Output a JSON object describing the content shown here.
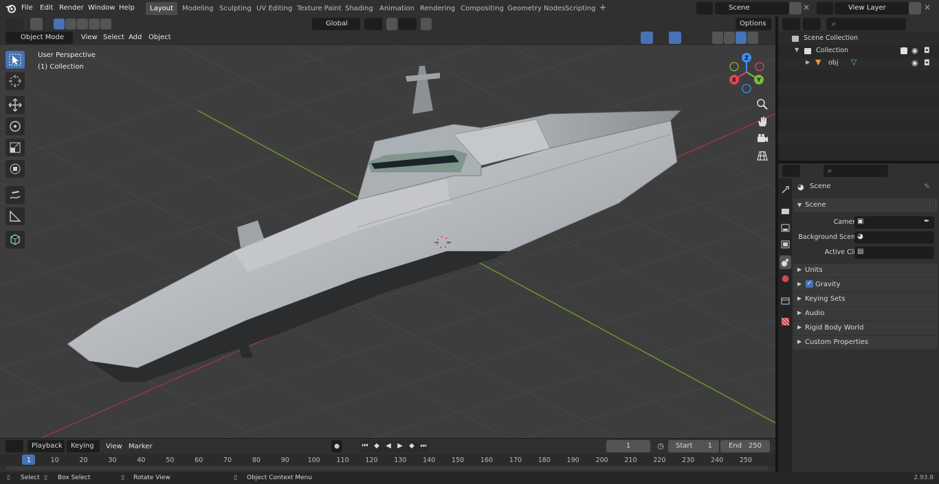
{
  "topbar": {
    "menus": [
      "File",
      "Edit",
      "Render",
      "Window",
      "Help"
    ],
    "workspaces": [
      "Layout",
      "Modeling",
      "Sculpting",
      "UV Editing",
      "Texture Paint",
      "Shading",
      "Animation",
      "Rendering",
      "Compositing",
      "Geometry Nodes",
      "Scripting"
    ],
    "active_workspace": "Layout",
    "scene_name": "Scene",
    "view_layer": "View Layer"
  },
  "viewport_header": {
    "mode": "Object Mode",
    "menus": [
      "View",
      "Select",
      "Add",
      "Object"
    ],
    "transform_orientation": "Global",
    "options_label": "Options"
  },
  "viewport": {
    "perspective_label": "User Perspective",
    "collection_label": "(1) Collection",
    "gizmo_axes": [
      "X",
      "Y",
      "Z"
    ]
  },
  "toolbar": {
    "tools": [
      "select-box",
      "cursor",
      "move",
      "rotate",
      "scale",
      "transform",
      "annotate",
      "measure",
      "add-cube"
    ],
    "active_tool": "select-box"
  },
  "outliner": {
    "root": "Scene Collection",
    "collection": "Collection",
    "object": "obj"
  },
  "properties": {
    "context_title": "Scene",
    "panel_scene": "Scene",
    "fields": [
      {
        "label": "Camera",
        "value": ""
      },
      {
        "label": "Background Scene",
        "value": ""
      },
      {
        "label": "Active Clip",
        "value": ""
      }
    ],
    "sections": [
      "Units",
      "Gravity",
      "Keying Sets",
      "Audio",
      "Rigid Body World",
      "Custom Properties"
    ],
    "gravity_checked": true
  },
  "timeline": {
    "menus": [
      "Playback",
      "Keying",
      "View",
      "Marker"
    ],
    "current_frame": "1",
    "start_label": "Start",
    "start_value": "1",
    "end_label": "End",
    "end_value": "250",
    "ruler": [
      "1",
      "10",
      "20",
      "30",
      "40",
      "50",
      "60",
      "70",
      "80",
      "90",
      "100",
      "110",
      "120",
      "130",
      "140",
      "150",
      "160",
      "170",
      "180",
      "190",
      "200",
      "210",
      "220",
      "230",
      "240",
      "250"
    ]
  },
  "statusbar": {
    "hints": [
      "Select",
      "Box Select",
      "Rotate View",
      "Object Context Menu"
    ],
    "version": "2.93.8"
  },
  "colors": {
    "accent": "#4772b3",
    "x_axis": "#e0455a",
    "y_axis": "#7cb83f",
    "z_axis": "#3e8ef0",
    "header": "#303030",
    "viewport_bg": "#3d3d3d"
  }
}
